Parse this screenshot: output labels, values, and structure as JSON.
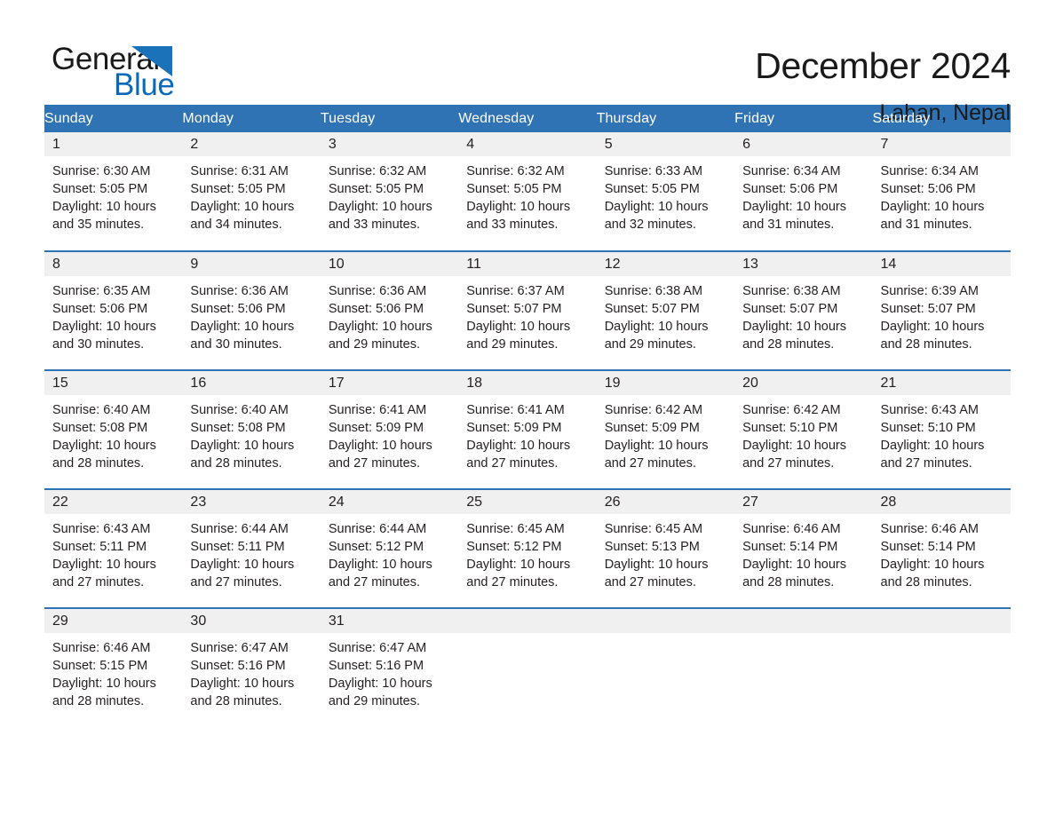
{
  "brand": {
    "name_top": "General",
    "name_bottom": "Blue",
    "triangle_color": "#1a72b8",
    "text_color": "#1a1a1a",
    "blue_color": "#0a6ab8"
  },
  "header": {
    "title": "December 2024",
    "location": "Lahan, Nepal"
  },
  "theme": {
    "accent": "#3073b4",
    "band": "#f0f0f0",
    "text": "#231f20",
    "header_text": "#ffffff"
  },
  "weekday_headers": [
    "Sunday",
    "Monday",
    "Tuesday",
    "Wednesday",
    "Thursday",
    "Friday",
    "Saturday"
  ],
  "weeks": [
    [
      {
        "day": "1",
        "sunrise": "Sunrise: 6:30 AM",
        "sunset": "Sunset: 5:05 PM",
        "daylight_1": "Daylight: 10 hours",
        "daylight_2": "and 35 minutes."
      },
      {
        "day": "2",
        "sunrise": "Sunrise: 6:31 AM",
        "sunset": "Sunset: 5:05 PM",
        "daylight_1": "Daylight: 10 hours",
        "daylight_2": "and 34 minutes."
      },
      {
        "day": "3",
        "sunrise": "Sunrise: 6:32 AM",
        "sunset": "Sunset: 5:05 PM",
        "daylight_1": "Daylight: 10 hours",
        "daylight_2": "and 33 minutes."
      },
      {
        "day": "4",
        "sunrise": "Sunrise: 6:32 AM",
        "sunset": "Sunset: 5:05 PM",
        "daylight_1": "Daylight: 10 hours",
        "daylight_2": "and 33 minutes."
      },
      {
        "day": "5",
        "sunrise": "Sunrise: 6:33 AM",
        "sunset": "Sunset: 5:05 PM",
        "daylight_1": "Daylight: 10 hours",
        "daylight_2": "and 32 minutes."
      },
      {
        "day": "6",
        "sunrise": "Sunrise: 6:34 AM",
        "sunset": "Sunset: 5:06 PM",
        "daylight_1": "Daylight: 10 hours",
        "daylight_2": "and 31 minutes."
      },
      {
        "day": "7",
        "sunrise": "Sunrise: 6:34 AM",
        "sunset": "Sunset: 5:06 PM",
        "daylight_1": "Daylight: 10 hours",
        "daylight_2": "and 31 minutes."
      }
    ],
    [
      {
        "day": "8",
        "sunrise": "Sunrise: 6:35 AM",
        "sunset": "Sunset: 5:06 PM",
        "daylight_1": "Daylight: 10 hours",
        "daylight_2": "and 30 minutes."
      },
      {
        "day": "9",
        "sunrise": "Sunrise: 6:36 AM",
        "sunset": "Sunset: 5:06 PM",
        "daylight_1": "Daylight: 10 hours",
        "daylight_2": "and 30 minutes."
      },
      {
        "day": "10",
        "sunrise": "Sunrise: 6:36 AM",
        "sunset": "Sunset: 5:06 PM",
        "daylight_1": "Daylight: 10 hours",
        "daylight_2": "and 29 minutes."
      },
      {
        "day": "11",
        "sunrise": "Sunrise: 6:37 AM",
        "sunset": "Sunset: 5:07 PM",
        "daylight_1": "Daylight: 10 hours",
        "daylight_2": "and 29 minutes."
      },
      {
        "day": "12",
        "sunrise": "Sunrise: 6:38 AM",
        "sunset": "Sunset: 5:07 PM",
        "daylight_1": "Daylight: 10 hours",
        "daylight_2": "and 29 minutes."
      },
      {
        "day": "13",
        "sunrise": "Sunrise: 6:38 AM",
        "sunset": "Sunset: 5:07 PM",
        "daylight_1": "Daylight: 10 hours",
        "daylight_2": "and 28 minutes."
      },
      {
        "day": "14",
        "sunrise": "Sunrise: 6:39 AM",
        "sunset": "Sunset: 5:07 PM",
        "daylight_1": "Daylight: 10 hours",
        "daylight_2": "and 28 minutes."
      }
    ],
    [
      {
        "day": "15",
        "sunrise": "Sunrise: 6:40 AM",
        "sunset": "Sunset: 5:08 PM",
        "daylight_1": "Daylight: 10 hours",
        "daylight_2": "and 28 minutes."
      },
      {
        "day": "16",
        "sunrise": "Sunrise: 6:40 AM",
        "sunset": "Sunset: 5:08 PM",
        "daylight_1": "Daylight: 10 hours",
        "daylight_2": "and 28 minutes."
      },
      {
        "day": "17",
        "sunrise": "Sunrise: 6:41 AM",
        "sunset": "Sunset: 5:09 PM",
        "daylight_1": "Daylight: 10 hours",
        "daylight_2": "and 27 minutes."
      },
      {
        "day": "18",
        "sunrise": "Sunrise: 6:41 AM",
        "sunset": "Sunset: 5:09 PM",
        "daylight_1": "Daylight: 10 hours",
        "daylight_2": "and 27 minutes."
      },
      {
        "day": "19",
        "sunrise": "Sunrise: 6:42 AM",
        "sunset": "Sunset: 5:09 PM",
        "daylight_1": "Daylight: 10 hours",
        "daylight_2": "and 27 minutes."
      },
      {
        "day": "20",
        "sunrise": "Sunrise: 6:42 AM",
        "sunset": "Sunset: 5:10 PM",
        "daylight_1": "Daylight: 10 hours",
        "daylight_2": "and 27 minutes."
      },
      {
        "day": "21",
        "sunrise": "Sunrise: 6:43 AM",
        "sunset": "Sunset: 5:10 PM",
        "daylight_1": "Daylight: 10 hours",
        "daylight_2": "and 27 minutes."
      }
    ],
    [
      {
        "day": "22",
        "sunrise": "Sunrise: 6:43 AM",
        "sunset": "Sunset: 5:11 PM",
        "daylight_1": "Daylight: 10 hours",
        "daylight_2": "and 27 minutes."
      },
      {
        "day": "23",
        "sunrise": "Sunrise: 6:44 AM",
        "sunset": "Sunset: 5:11 PM",
        "daylight_1": "Daylight: 10 hours",
        "daylight_2": "and 27 minutes."
      },
      {
        "day": "24",
        "sunrise": "Sunrise: 6:44 AM",
        "sunset": "Sunset: 5:12 PM",
        "daylight_1": "Daylight: 10 hours",
        "daylight_2": "and 27 minutes."
      },
      {
        "day": "25",
        "sunrise": "Sunrise: 6:45 AM",
        "sunset": "Sunset: 5:12 PM",
        "daylight_1": "Daylight: 10 hours",
        "daylight_2": "and 27 minutes."
      },
      {
        "day": "26",
        "sunrise": "Sunrise: 6:45 AM",
        "sunset": "Sunset: 5:13 PM",
        "daylight_1": "Daylight: 10 hours",
        "daylight_2": "and 27 minutes."
      },
      {
        "day": "27",
        "sunrise": "Sunrise: 6:46 AM",
        "sunset": "Sunset: 5:14 PM",
        "daylight_1": "Daylight: 10 hours",
        "daylight_2": "and 28 minutes."
      },
      {
        "day": "28",
        "sunrise": "Sunrise: 6:46 AM",
        "sunset": "Sunset: 5:14 PM",
        "daylight_1": "Daylight: 10 hours",
        "daylight_2": "and 28 minutes."
      }
    ],
    [
      {
        "day": "29",
        "sunrise": "Sunrise: 6:46 AM",
        "sunset": "Sunset: 5:15 PM",
        "daylight_1": "Daylight: 10 hours",
        "daylight_2": "and 28 minutes."
      },
      {
        "day": "30",
        "sunrise": "Sunrise: 6:47 AM",
        "sunset": "Sunset: 5:16 PM",
        "daylight_1": "Daylight: 10 hours",
        "daylight_2": "and 28 minutes."
      },
      {
        "day": "31",
        "sunrise": "Sunrise: 6:47 AM",
        "sunset": "Sunset: 5:16 PM",
        "daylight_1": "Daylight: 10 hours",
        "daylight_2": "and 29 minutes."
      },
      {
        "day": "",
        "sunrise": "",
        "sunset": "",
        "daylight_1": "",
        "daylight_2": ""
      },
      {
        "day": "",
        "sunrise": "",
        "sunset": "",
        "daylight_1": "",
        "daylight_2": ""
      },
      {
        "day": "",
        "sunrise": "",
        "sunset": "",
        "daylight_1": "",
        "daylight_2": ""
      },
      {
        "day": "",
        "sunrise": "",
        "sunset": "",
        "daylight_1": "",
        "daylight_2": ""
      }
    ]
  ]
}
